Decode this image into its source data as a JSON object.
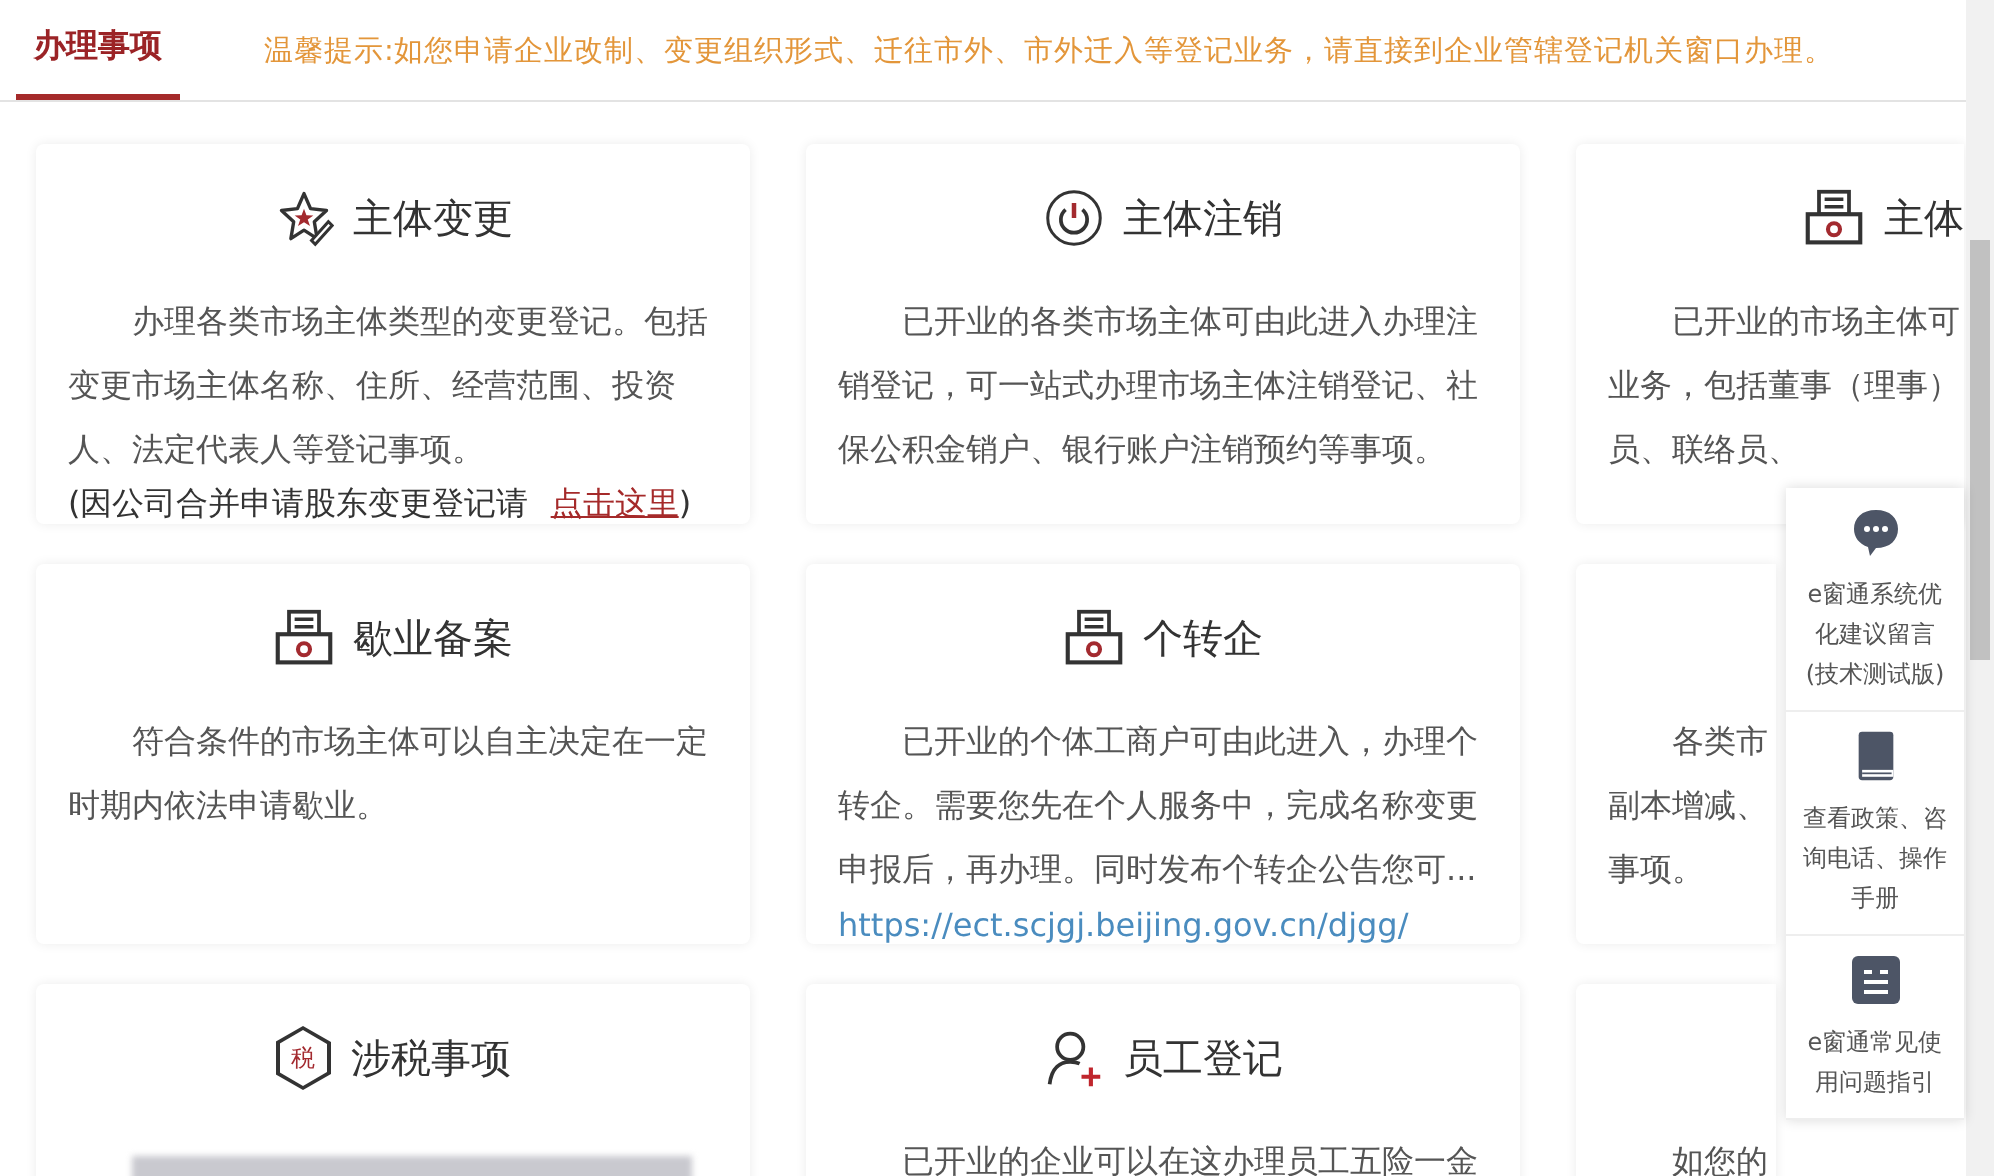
{
  "header": {
    "tab": {
      "label": "办理事项",
      "selected": true
    },
    "notice": "温馨提示:如您申请企业改制、变更组织形式、迁往市外、市外迁入等登记业务，请直接到企业管辖登记机关窗口办理。"
  },
  "cards": [
    {
      "title": "主体变更",
      "body": "办理各类市场主体类型的变更登记。包括变更市场主体名称、住所、经营范围、投资人、法定代表人等登记事项。",
      "note": {
        "before": "(因公司合并申请股东变更登记请 ",
        "link": "点击这里",
        "after": ")"
      }
    },
    {
      "title": "主体注销",
      "body": "已开业的各类市场主体可由此进入办理注销登记，可一站式办理市场主体注销登记、社保公积金销户、银行账户注销预约等事项。"
    },
    {
      "title": "主体",
      "body": "已开业的市场主体可业务，包括董事（理事）员、联络员、"
    },
    {
      "title": "歇业备案",
      "body": "符合条件的市场主体可以自主决定在一定时期内依法申请歇业。"
    },
    {
      "title": "个转企",
      "body": "已开业的个体工商户可由此进入，办理个转企。需要您先在个人服务中，完成名称变更申报后，再办理。同时发布个转企公告您可...",
      "link": "https://ect.scjgj.beijing.gov.cn/djgg/"
    },
    {
      "body": "各类市副本增减、事项。"
    },
    {
      "icon_text": "税",
      "title": "涉税事项",
      "blurred_body": true
    },
    {
      "title": "员工登记",
      "body": "已开业的企业可以在这办理员工五险一金"
    },
    {
      "body": "如您的"
    }
  ],
  "float_panel": [
    {
      "label": "e窗通系统优化建议留言(技术测试版)"
    },
    {
      "label": "查看政策、咨询电话、操作手册"
    },
    {
      "label": "e窗通常见使用问题指引"
    }
  ]
}
